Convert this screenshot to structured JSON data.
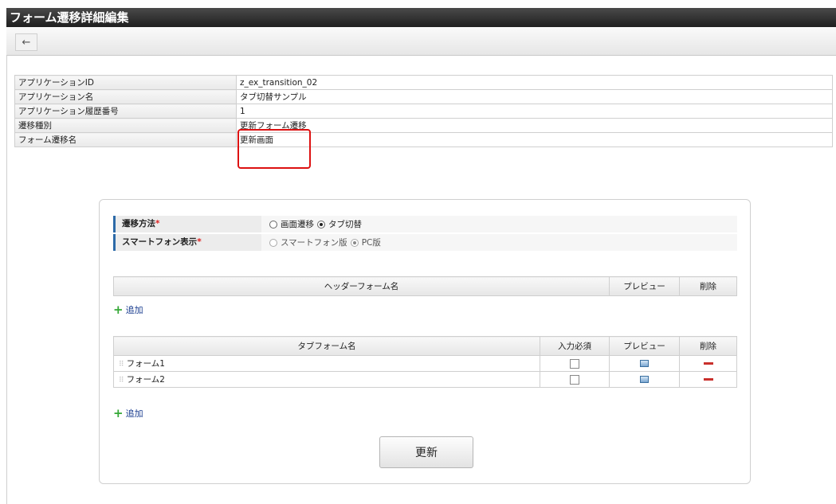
{
  "window": {
    "title": "フォーム遷移詳細編集"
  },
  "toolbar": {
    "back_icon": "arrow-left"
  },
  "info": {
    "rows": [
      {
        "key": "アプリケーションID",
        "value": "z_ex_transition_02"
      },
      {
        "key": "アプリケーション名",
        "value": "タブ切替サンプル"
      },
      {
        "key": "アプリケーション履歴番号",
        "value": "1"
      },
      {
        "key": "遷移種別",
        "value": "更新フォーム遷移"
      },
      {
        "key": "フォーム遷移名",
        "value": "更新画面"
      }
    ]
  },
  "settings": {
    "transition_method": {
      "label": "遷移方法",
      "required_mark": "*",
      "options": [
        "画面遷移",
        "タブ切替"
      ],
      "selected": "タブ切替"
    },
    "smartphone_display": {
      "label": "スマートフォン表示",
      "required_mark": "*",
      "options": [
        "スマートフォン版",
        "PC版"
      ],
      "selected": "PC版"
    }
  },
  "header_forms": {
    "columns": [
      "ヘッダーフォーム名",
      "プレビュー",
      "削除"
    ],
    "add_label": "追加"
  },
  "tab_forms": {
    "columns": [
      "タブフォーム名",
      "入力必須",
      "プレビュー",
      "削除"
    ],
    "rows": [
      {
        "name": "フォーム1",
        "required": false
      },
      {
        "name": "フォーム2",
        "required": false
      }
    ],
    "add_label": "追加"
  },
  "actions": {
    "update_label": "更新"
  },
  "colors": {
    "highlight": "#dd1111",
    "accent": "#2d6aa8",
    "delete": "#c9302c",
    "add": "#35a836"
  }
}
